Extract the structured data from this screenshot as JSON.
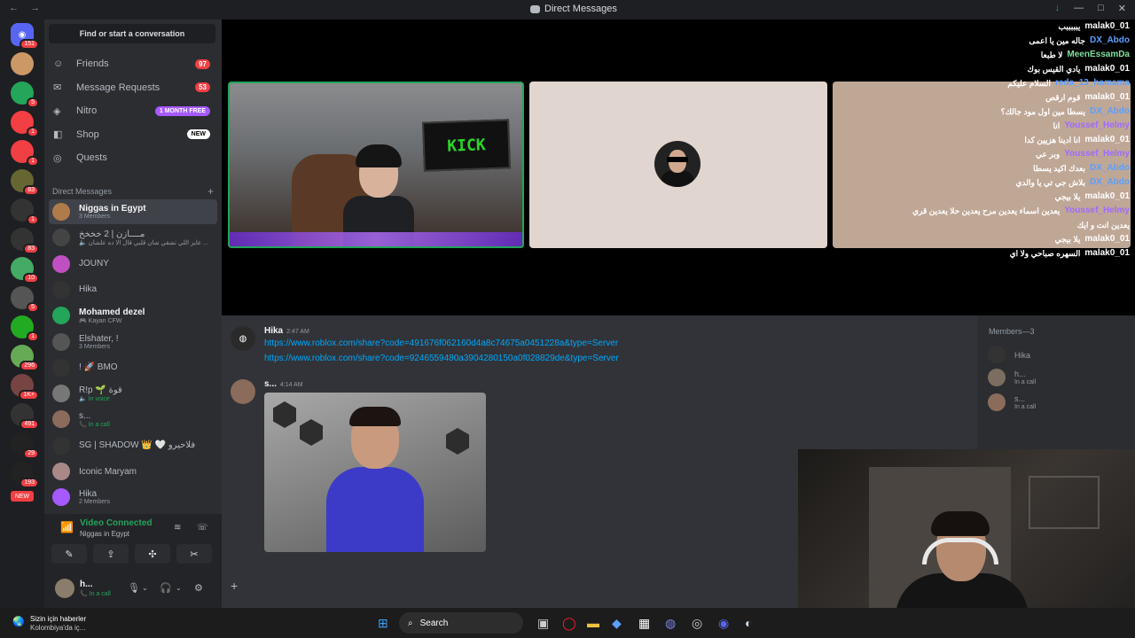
{
  "titlebar": {
    "back": "←",
    "forward": "→",
    "title": "Direct Messages",
    "icon": "discord-icon",
    "download": "↓",
    "minimize": "—",
    "maximize": "□",
    "close": "✕"
  },
  "servers": {
    "home_badge": "151",
    "items": [
      {
        "badge": "",
        "color": "#c96"
      },
      {
        "badge": "5",
        "color": "#23a55a"
      },
      {
        "badge": "1",
        "color": "#f23f43"
      },
      {
        "badge": "1",
        "color": "#f23f43"
      },
      {
        "badge": "83",
        "color": "#663"
      },
      {
        "badge": "1",
        "color": "#333"
      },
      {
        "badge": "83",
        "color": "#333"
      },
      {
        "badge": "10",
        "color": "#4a6"
      },
      {
        "badge": "5",
        "color": "#555"
      },
      {
        "badge": "1",
        "color": "#2a2"
      },
      {
        "badge": "296",
        "color": "#6a5"
      },
      {
        "badge": "1K+",
        "color": "#744"
      },
      {
        "badge": "491",
        "color": "#333"
      },
      {
        "badge": "29",
        "color": "#222"
      },
      {
        "badge": "193",
        "color": "#222"
      }
    ],
    "new_label": "NEW"
  },
  "sidebar": {
    "find_label": "Find or start a conversation",
    "nav": [
      {
        "label": "Friends",
        "icon": "friends-icon",
        "badge": "97"
      },
      {
        "label": "Message Requests",
        "icon": "mail-icon",
        "badge": "53"
      },
      {
        "label": "Nitro",
        "icon": "nitro-icon",
        "pill": "1 MONTH FREE"
      },
      {
        "label": "Shop",
        "icon": "shop-icon",
        "pillw": "NEW"
      },
      {
        "label": "Quests",
        "icon": "quests-icon"
      }
    ],
    "dm_header": "Direct Messages",
    "dm_plus": "+",
    "dms": [
      {
        "name": "Niggas in Egypt",
        "sub": "3 Members",
        "color": "#b07b4a",
        "active": true
      },
      {
        "name": "مــــازن  | 2 خخخخ",
        "sub": "🔈 عايز اللي تشقي شان قلبي قال الا ده علشان ...",
        "color": "#444"
      },
      {
        "name": "JOUNY",
        "sub": "",
        "color": "#c050c0"
      },
      {
        "name": "Hika",
        "sub": "",
        "color": "#333"
      },
      {
        "name": "Mohamed dezel",
        "sub": "🎮 Kayan CFW",
        "color": "#23a55a",
        "bold": true
      },
      {
        "name": "Elshater, !",
        "sub": "3 Members",
        "color": "#555"
      },
      {
        "name": "! 🚀 BMO",
        "sub": "",
        "color": "#333"
      },
      {
        "name": "R!p 🌱 قوة",
        "sub": "🔈 In voice",
        "color": "#777",
        "green": true
      },
      {
        "name": "s...",
        "sub": "📞 In a call",
        "color": "#8b6b5b",
        "green": true
      },
      {
        "name": "SG | SHADOW 👑 🤍 فلاحيرو",
        "sub": "",
        "color": "#333"
      },
      {
        "name": "Iconic Maryam",
        "sub": "",
        "color": "#a88"
      },
      {
        "name": "Hika",
        "sub": "2 Members",
        "color": "#a659ff"
      }
    ]
  },
  "voice": {
    "status": "Video Connected",
    "channel": "Niggas in Egypt",
    "signal_icon": "📶",
    "buttons": [
      "✎",
      "⇪",
      "✣",
      "✂"
    ],
    "noise": "≋",
    "hangup": "☏"
  },
  "user": {
    "name": "h...",
    "status": "📞 In a call",
    "mic": "🎙",
    "headset": "🎧",
    "settings": "⚙",
    "chev": "⌄"
  },
  "notification": {
    "icon": "🌏",
    "title": "Sizin için haberler",
    "body": "Kolombiya'da iç..."
  },
  "stage": {
    "kick_text": "KICK",
    "overlay": [
      {
        "user": "malak0_01",
        "msg": "يبببببب",
        "color": ""
      },
      {
        "user": "DX_Abdo",
        "msg": "جاله مين يا اعمى",
        "color": "blue"
      },
      {
        "user": "MeenEssamDa",
        "msg": "لا طبعا",
        "color": "green"
      },
      {
        "user": "malak0_01",
        "msg": "يادي القيس بوك",
        "color": ""
      },
      {
        "user": "reda_13_hamama",
        "msg": "السلام عليكم",
        "color": "blue"
      },
      {
        "user": "malak0_01",
        "msg": "قوم ارقص",
        "color": ""
      },
      {
        "user": "DX_Abdo",
        "msg": "يسطا مين اول مود جالك؟",
        "color": "blue"
      },
      {
        "user": "Youssef_Helmy",
        "msg": "انا",
        "color": "purple"
      },
      {
        "user": "malak0_01",
        "msg": "انا ادينا هزيين كدا",
        "color": ""
      },
      {
        "user": "Youssef_Helmy",
        "msg": "وبر عي",
        "color": "purple"
      },
      {
        "user": "DX_Abdo",
        "msg": "بعدك اكيد يسطا",
        "color": "blue"
      },
      {
        "user": "DX_Abdo",
        "msg": "بلاش جي تي يا والدي",
        "color": "blue"
      },
      {
        "user": "malak0_01",
        "msg": "يلا بيجي",
        "color": ""
      },
      {
        "user": "Youssef_Helmy",
        "msg": "يعدين اسماء يعدين مرح يعدين حلا يعدين قري",
        "color": "purple"
      },
      {
        "user": "",
        "msg": "يعدين انت و ايك",
        "color": ""
      },
      {
        "user": "malak0_01",
        "msg": "يلا بيجي",
        "color": ""
      },
      {
        "user": "malak0_01",
        "msg": "السهره صباحي ولا اي",
        "color": ""
      }
    ]
  },
  "chat": {
    "messages": [
      {
        "author": "Hika",
        "time": "2:47 AM",
        "lines": [
          "https://www.roblox.com/share?code=491676f062160d4a8c74675a0451228a&type=Server",
          "https://www.roblox.com/share?code=9246559480a3904280150a0f028829de&type=Server"
        ]
      },
      {
        "author": "s...",
        "time": "4:14 AM",
        "lines": []
      }
    ],
    "composer_plus": "+"
  },
  "members": {
    "header": "Members—3",
    "items": [
      {
        "name": "Hika",
        "status": ""
      },
      {
        "name": "h...",
        "status": "In a call"
      },
      {
        "name": "s...",
        "status": "In a call"
      }
    ]
  },
  "taskbar": {
    "search_label": "Search",
    "icons": [
      "windows-icon",
      "file-explorer-icon",
      "opera-icon",
      "folder-icon",
      "copilot-icon",
      "store-icon",
      "teams-icon",
      "chrome-icon",
      "discord-icon",
      "steam-icon"
    ]
  }
}
